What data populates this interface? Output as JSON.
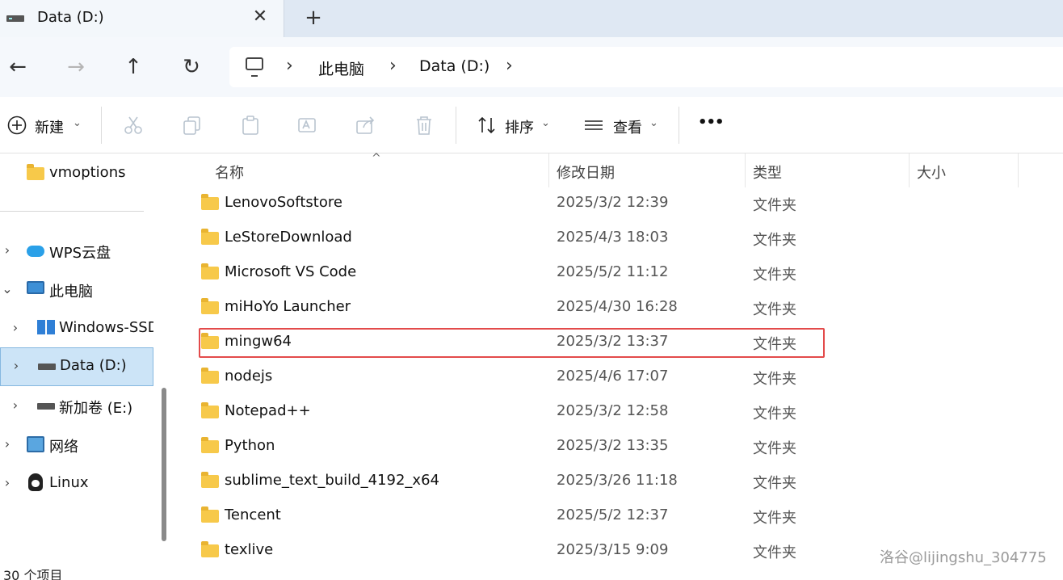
{
  "tab": {
    "title": "Data (D:)",
    "close_glyph": "✕",
    "new_glyph": "+"
  },
  "nav": {
    "back": "←",
    "forward": "→",
    "up": "↑",
    "refresh": "↻"
  },
  "breadcrumb": {
    "sep": "›",
    "items": [
      "此电脑",
      "Data (D:)"
    ]
  },
  "toolbar": {
    "new_label": "新建",
    "sort_label": "排序",
    "view_label": "查看",
    "more_glyph": "•••",
    "chevron": "⌄",
    "icons": {
      "new": "plus-circle-icon",
      "cut": "scissors-icon",
      "copy": "copy-icon",
      "paste": "clipboard-icon",
      "rename": "rename-icon",
      "share": "share-icon",
      "delete": "trash-icon",
      "sort": "sort-icon",
      "view": "list-view-icon"
    }
  },
  "sidebar": {
    "items": [
      {
        "label": "vmoptions",
        "icon": "folder-icon"
      },
      {
        "label": "WPS云盘",
        "icon": "cloud-icon"
      },
      {
        "label": "此电脑",
        "icon": "monitor-icon"
      },
      {
        "label": "Windows-SSD",
        "icon": "windows-drive-icon"
      },
      {
        "label": "Data (D:)",
        "icon": "drive-icon"
      },
      {
        "label": "新加卷 (E:)",
        "icon": "drive-icon"
      },
      {
        "label": "网络",
        "icon": "network-icon"
      },
      {
        "label": "Linux",
        "icon": "linux-icon"
      }
    ],
    "chev_right": "›",
    "chev_down": "⌄"
  },
  "columns": {
    "name": "名称",
    "date": "修改日期",
    "type": "类型",
    "size": "大小",
    "sort_caret": "^"
  },
  "files": [
    {
      "name": "LenovoSoftstore",
      "date": "2025/3/2 12:39",
      "type": "文件夹"
    },
    {
      "name": "LeStoreDownload",
      "date": "2025/4/3 18:03",
      "type": "文件夹"
    },
    {
      "name": "Microsoft VS Code",
      "date": "2025/5/2 11:12",
      "type": "文件夹"
    },
    {
      "name": "miHoYo Launcher",
      "date": "2025/4/30 16:28",
      "type": "文件夹"
    },
    {
      "name": "mingw64",
      "date": "2025/3/2 13:37",
      "type": "文件夹"
    },
    {
      "name": "nodejs",
      "date": "2025/4/6 17:07",
      "type": "文件夹"
    },
    {
      "name": "Notepad++",
      "date": "2025/3/2 12:58",
      "type": "文件夹"
    },
    {
      "name": "Python",
      "date": "2025/3/2 13:35",
      "type": "文件夹"
    },
    {
      "name": "sublime_text_build_4192_x64",
      "date": "2025/3/26 11:18",
      "type": "文件夹"
    },
    {
      "name": "Tencent",
      "date": "2025/5/2 12:37",
      "type": "文件夹"
    },
    {
      "name": "texlive",
      "date": "2025/3/15 9:09",
      "type": "文件夹"
    }
  ],
  "status": {
    "count": "30 个项目"
  },
  "watermark": "洛谷@lijingshu_304775",
  "colors": {
    "selection": "#cce4f7",
    "highlight": "#e34b4b",
    "folder": "#f7c94a"
  }
}
